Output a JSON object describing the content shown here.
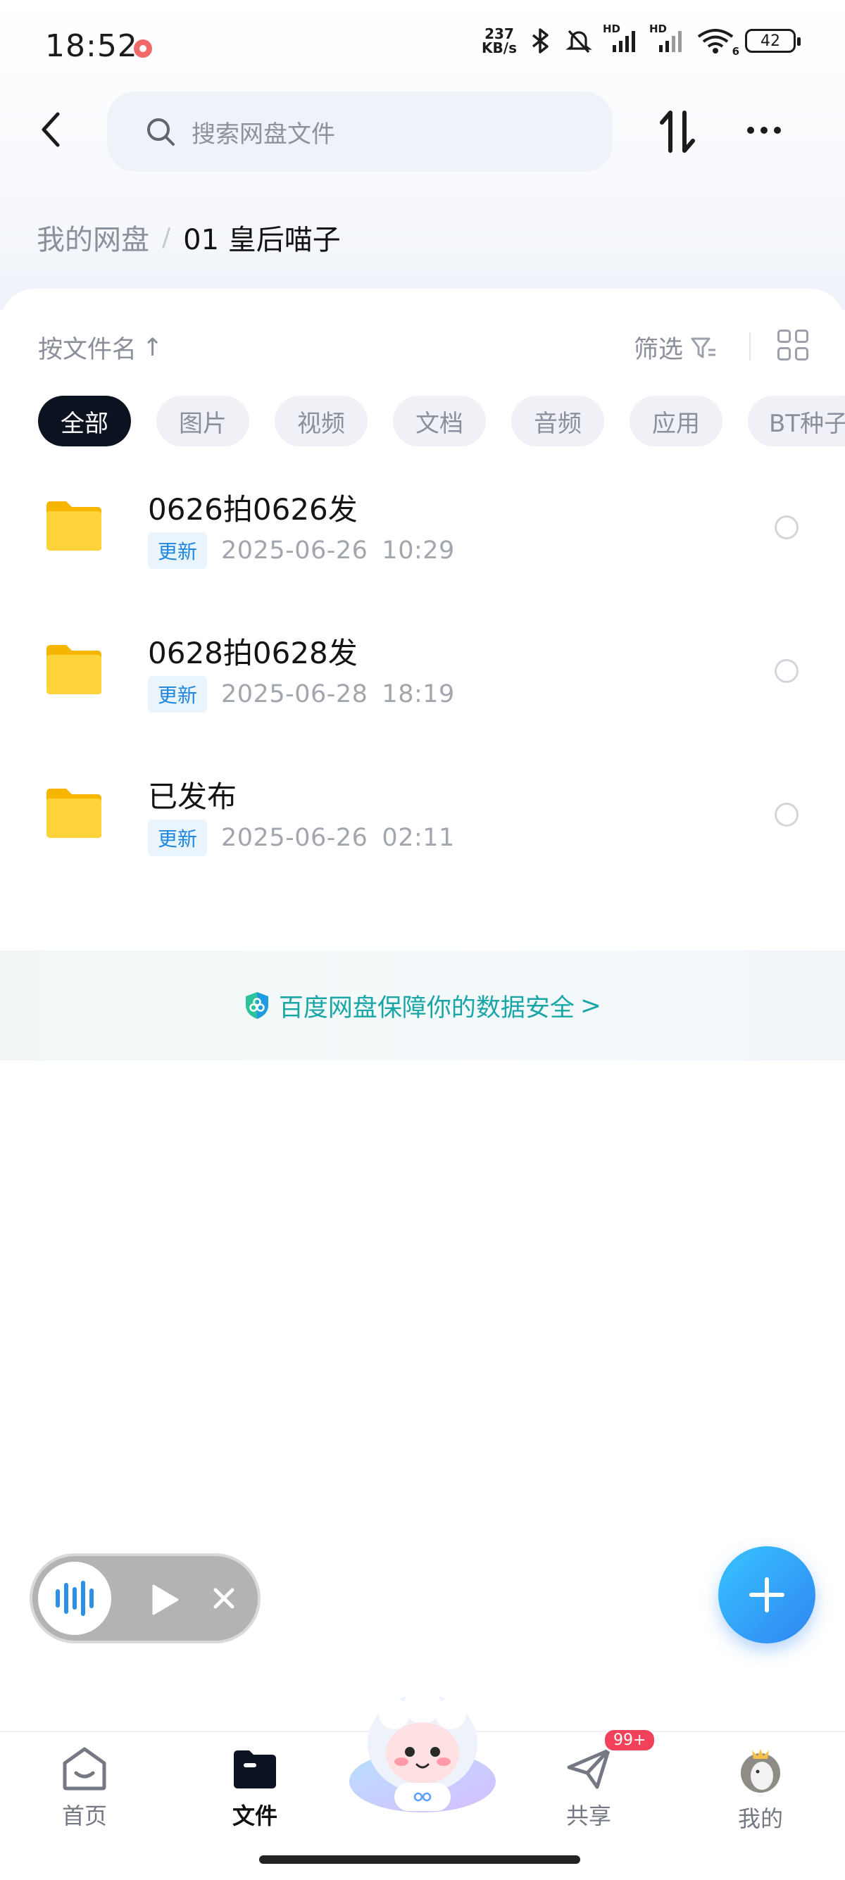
{
  "status_bar": {
    "time": "18:52",
    "net_speed_value": "237",
    "net_speed_unit": "KB/s",
    "battery": "42",
    "signal_label_1": "HD",
    "signal_label_2": "HD",
    "wifi_label": "6"
  },
  "header": {
    "search_placeholder": "搜索网盘文件"
  },
  "breadcrumb": {
    "root": "我的网盘",
    "separator": "/",
    "current": "01 皇后喵子"
  },
  "toolbar": {
    "sort_label": "按文件名",
    "sort_arrow": "↑",
    "filter_label": "筛选"
  },
  "categories": [
    {
      "label": "全部",
      "active": true
    },
    {
      "label": "图片",
      "active": false
    },
    {
      "label": "视频",
      "active": false
    },
    {
      "label": "文档",
      "active": false
    },
    {
      "label": "音频",
      "active": false
    },
    {
      "label": "应用",
      "active": false
    },
    {
      "label": "BT种子",
      "active": false
    }
  ],
  "files": [
    {
      "name": "0626拍0626发",
      "badge": "更新",
      "date": "2025-06-26",
      "time": "10:29"
    },
    {
      "name": "0628拍0628发",
      "badge": "更新",
      "date": "2025-06-28",
      "time": "18:19"
    },
    {
      "name": "已发布",
      "badge": "更新",
      "date": "2025-06-26",
      "time": "02:11"
    }
  ],
  "safety_banner": {
    "text": "百度网盘保障你的数据安全",
    "chevron": ">"
  },
  "share_badge": "99+",
  "bottom_nav": [
    {
      "label": "首页",
      "icon": "home-icon",
      "active": false
    },
    {
      "label": "文件",
      "icon": "folder-icon",
      "active": true
    },
    {
      "label": "共享",
      "icon": "send-icon",
      "active": false
    },
    {
      "label": "我的",
      "icon": "avatar",
      "active": false
    }
  ],
  "colors": {
    "accent": "#2f86f2",
    "safety_text": "#1aa6a6",
    "badge_text": "#1f86e0",
    "active_chip": "#0c1320",
    "folder": "#ffcd2e"
  }
}
